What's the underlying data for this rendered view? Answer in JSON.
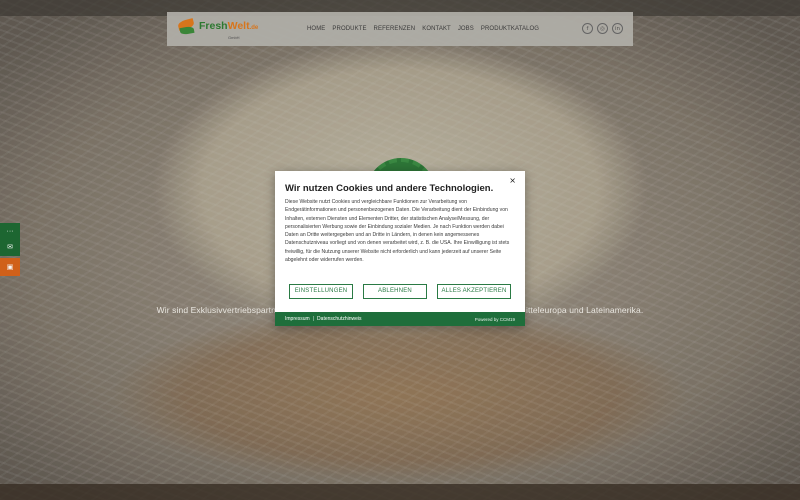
{
  "header": {
    "logo": {
      "brand_fresh": "Fresh",
      "brand_welt": "Welt",
      "brand_tld": ".de",
      "sub": "GmbH"
    },
    "nav": [
      "HOME",
      "PRODUKTE",
      "REFERENZEN",
      "KONTAKT",
      "JOBS",
      "PRODUKTKATALOG"
    ],
    "social": [
      {
        "icon": "facebook-icon",
        "glyph": "f"
      },
      {
        "icon": "instagram-icon",
        "glyph": "◎"
      },
      {
        "icon": "linkedin-icon",
        "glyph": "in"
      }
    ]
  },
  "side_tabs": [
    {
      "icon": "dots-icon",
      "glyph": "···"
    },
    {
      "icon": "mail-icon",
      "glyph": "✉"
    },
    {
      "icon": "briefcase-icon",
      "glyph": "▣"
    }
  ],
  "hero": {
    "tagline_left": "Wir sind Exklusivvertriebspartn",
    "tagline_right": "itteleuropa und Lateinamerika."
  },
  "cookie_modal": {
    "close": "×",
    "title": "Wir nutzen Cookies und andere Technologien.",
    "body": "Diese Website nutzt Cookies und vergleichbare Funktionen zur Verarbeitung von Endgerätinformationen und personenbezogenen Daten. Die Verarbeitung dient der Einbindung von Inhalten, externen Diensten und Elementen Dritter, der statistischen Analyse/Messung, der personalisierten Werbung sowie der Einbindung sozialer Medien. Je nach Funktion werden dabei Daten an Dritte weitergegeben und an Dritte in Ländern, in denen kein angemessenes Datenschutzniveau vorliegt und von denen verarbeitet wird, z. B. die USA. Ihre Einwilligung ist stets freiwillig, für die Nutzung unserer Website nicht erforderlich und kann jederzeit auf unserer Seite abgelehnt oder widerrufen werden.",
    "buttons": {
      "settings": "EINSTELLUNGEN",
      "decline": "ABLEHNEN",
      "accept": "ALLES AKZEPTIEREN"
    },
    "footer": {
      "impressum": "Impressum",
      "separator": "|",
      "privacy": "Datenschutzhinweis",
      "powered": "Powered by CCM19"
    }
  },
  "colors": {
    "brand_green": "#1e6e3b",
    "brand_orange": "#e07a1e",
    "button_border": "#2a7a44"
  }
}
